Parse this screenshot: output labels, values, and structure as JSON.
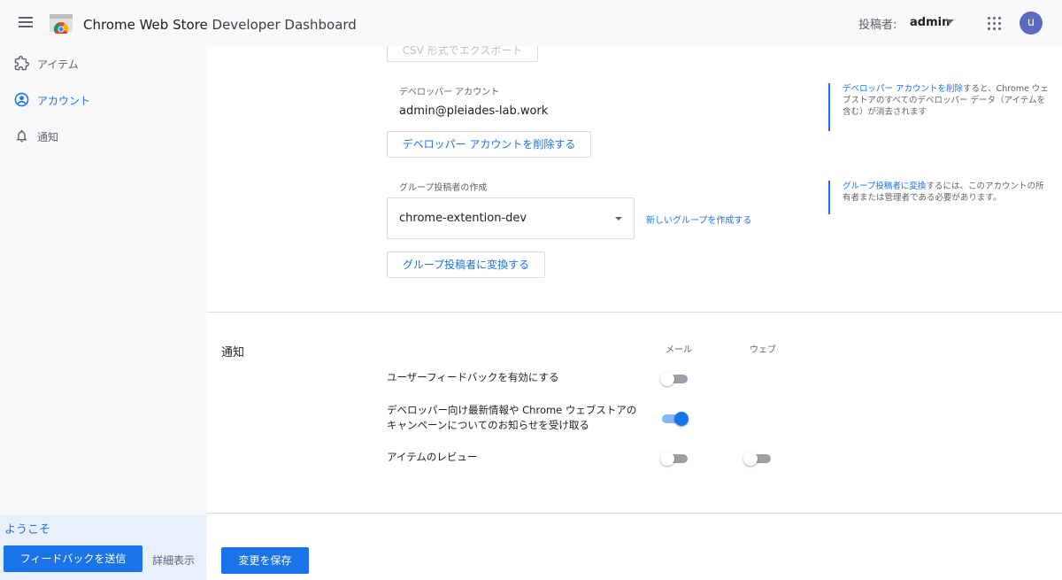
{
  "header": {
    "title": "Chrome Web Store",
    "subtitle": "Developer Dashboard",
    "publisher_label": "投稿者:",
    "publisher_value": "admin",
    "avatar_initial": "u"
  },
  "sidebar": {
    "items": [
      {
        "label": "アイテム",
        "icon": "puzzle-icon",
        "active": false
      },
      {
        "label": "アカウント",
        "icon": "account-circle-icon",
        "active": true
      },
      {
        "label": "通知",
        "icon": "bell-icon",
        "active": false
      }
    ],
    "welcome": "ようこそ",
    "feedback_button": "フィードバックを送信",
    "details_link": "詳細表示"
  },
  "account": {
    "csv_export_button": "CSV 形式でエクスポート",
    "developer_account_label": "デベロッパー アカウント",
    "developer_account_email": "admin@pleiades-lab.work",
    "delete_account_button": "デベロッパー アカウントを削除する",
    "delete_help_link": "デベロッパー アカウントを削除",
    "delete_help_text": "すると、Chrome ウェブストアのすべてのデベロッパー データ（アイテムを含む）が消去されます",
    "group_label": "グループ投稿者の作成",
    "group_selected": "chrome-extention-dev",
    "new_group_link": "新しいグループを作成する",
    "convert_group_button": "グループ投稿者に変換する",
    "convert_help_link": "グループ投稿者に変換",
    "convert_help_text": "するには、このアカウントの所有者または管理者である必要があります。"
  },
  "notifications": {
    "section_title": "通知",
    "col_mail": "メール",
    "col_web": "ウェブ",
    "rows": [
      {
        "label": "ユーザーフィードバックを有効にする",
        "mail": false
      },
      {
        "label_line1": "デベロッパー向け最新情報や Chrome ウェブストアの",
        "label_line2": "キャンペーンについてのお知らせを受け取る",
        "mail": true
      },
      {
        "label": "アイテムのレビュー",
        "mail": false,
        "web": false
      }
    ]
  },
  "footer": {
    "save_button": "変更を保存"
  },
  "colors": {
    "accent": "#1a73e8",
    "sidebar_bg": "#f8f9fa",
    "welcome_bg": "#e8f0fe",
    "avatar": "#5c6bc0"
  }
}
